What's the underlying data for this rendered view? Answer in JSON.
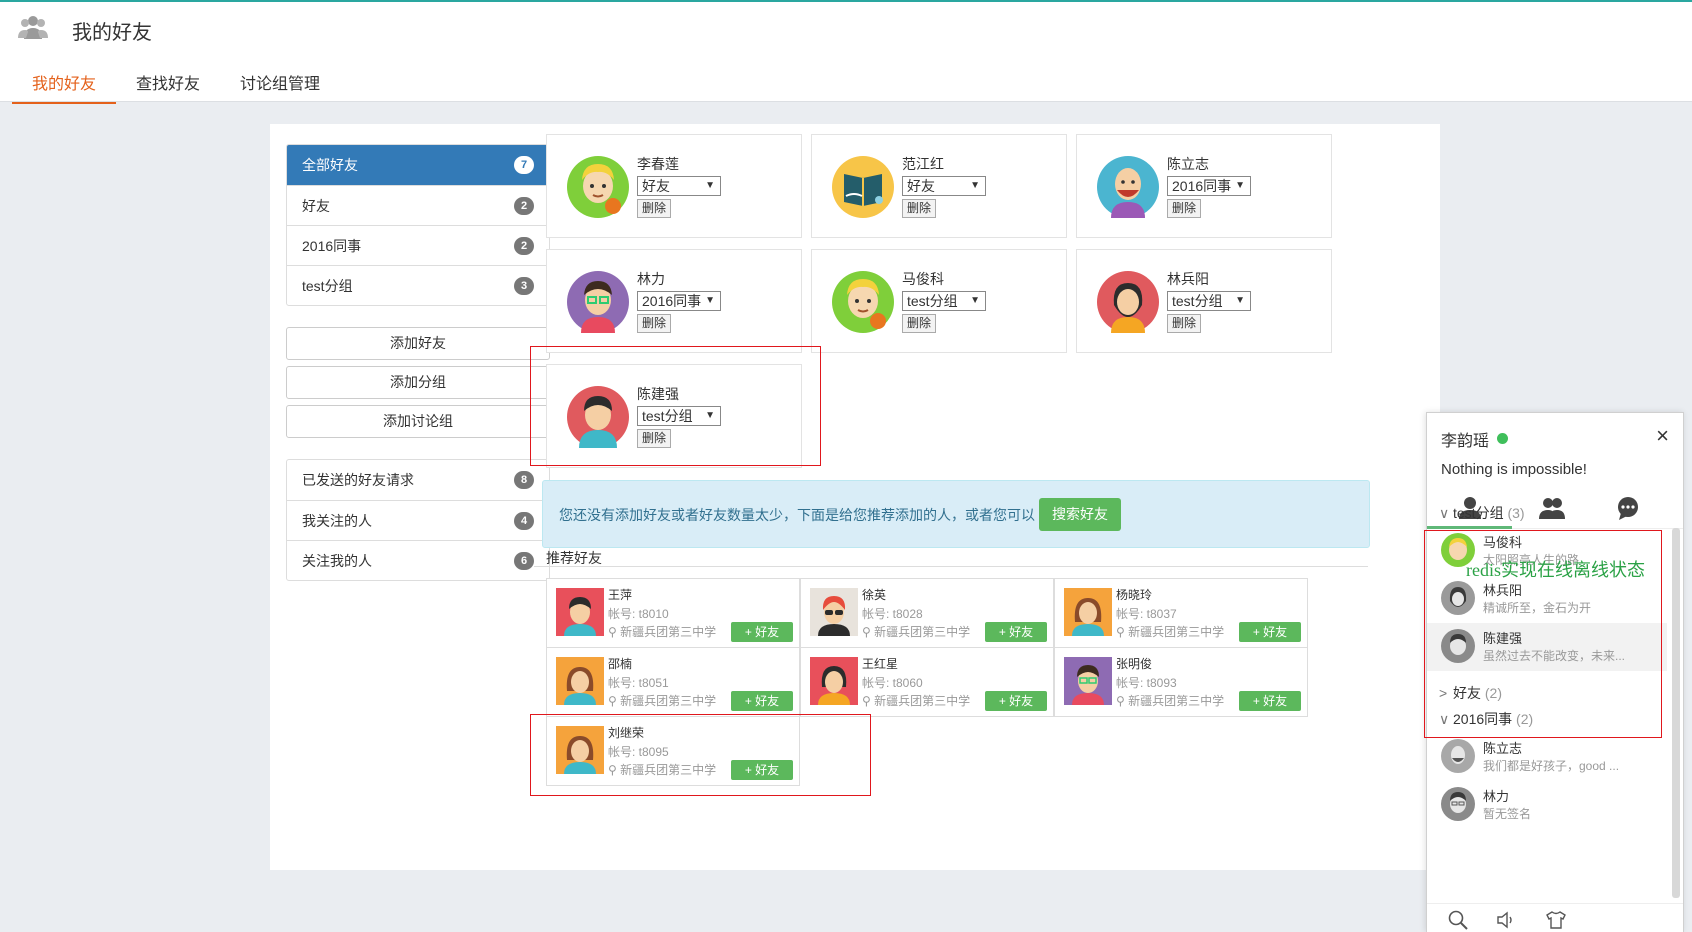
{
  "header": {
    "title": "我的好友"
  },
  "tabs": [
    {
      "label": "我的好友",
      "active": true
    },
    {
      "label": "查找好友",
      "active": false
    },
    {
      "label": "讨论组管理",
      "active": false
    }
  ],
  "sidebar": {
    "groups": [
      {
        "label": "全部好友",
        "count": "7",
        "active": true
      },
      {
        "label": "好友",
        "count": "2"
      },
      {
        "label": "2016同事",
        "count": "2"
      },
      {
        "label": "test分组",
        "count": "3"
      }
    ],
    "actions": [
      {
        "label": "添加好友"
      },
      {
        "label": "添加分组"
      },
      {
        "label": "添加讨论组"
      }
    ],
    "requests": [
      {
        "label": "已发送的好友请求",
        "count": "8"
      },
      {
        "label": "我关注的人",
        "count": "4"
      },
      {
        "label": "关注我的人",
        "count": "6"
      }
    ]
  },
  "friends": [
    {
      "name": "李春莲",
      "group": "好友",
      "delete_label": "删除"
    },
    {
      "name": "范江红",
      "group": "好友",
      "delete_label": "删除"
    },
    {
      "name": "陈立志",
      "group": "2016同事",
      "delete_label": "删除"
    },
    {
      "name": "林力",
      "group": "2016同事",
      "delete_label": "删除"
    },
    {
      "name": "马俊科",
      "group": "test分组",
      "delete_label": "删除"
    },
    {
      "name": "林兵阳",
      "group": "test分组",
      "delete_label": "删除"
    },
    {
      "name": "陈建强",
      "group": "test分组",
      "delete_label": "删除"
    }
  ],
  "notice": {
    "text": "您还没有添加好友或者好友数量太少，下面是给您推荐添加的人，或者您可以",
    "button": "搜索好友"
  },
  "recommend": {
    "title": "推荐好友",
    "account_prefix": "帐号:",
    "add_label": "+ 好友",
    "items": [
      {
        "name": "王萍",
        "account": "帐号: t8010",
        "school": "新疆兵团第三中学"
      },
      {
        "name": "徐英",
        "account": "帐号: t8028",
        "school": "新疆兵团第三中学"
      },
      {
        "name": "杨晓玲",
        "account": "帐号: t8037",
        "school": "新疆兵团第三中学"
      },
      {
        "name": "邵楠",
        "account": "帐号: t8051",
        "school": "新疆兵团第三中学"
      },
      {
        "name": "王红星",
        "account": "帐号: t8060",
        "school": "新疆兵团第三中学"
      },
      {
        "name": "张明俊",
        "account": "帐号: t8093",
        "school": "新疆兵团第三中学"
      },
      {
        "name": "刘继荣",
        "account": "帐号: t8095",
        "school": "新疆兵团第三中学"
      }
    ]
  },
  "chat": {
    "user_name": "李韵瑶",
    "close": "×",
    "signature": "Nothing is impossible!",
    "groups": [
      {
        "label": "test分组",
        "count": "(3)",
        "arrow": "∨"
      },
      {
        "label": "好友",
        "count": "(2)",
        "arrow": ">"
      },
      {
        "label": "2016同事",
        "count": "(2)",
        "arrow": "∨"
      }
    ],
    "members": [
      {
        "name": "马俊科",
        "sign": "太阳照亮人生的路"
      },
      {
        "name": "林兵阳",
        "sign": "精诚所至，金石为开"
      },
      {
        "name": "陈建强",
        "sign": "虽然过去不能改变，未来..."
      },
      {
        "name": "陈立志",
        "sign": "我们都是好孩子，good ..."
      },
      {
        "name": "林力",
        "sign": "暂无签名"
      }
    ]
  },
  "annotation": {
    "text": "redis实现在线离线状态"
  }
}
